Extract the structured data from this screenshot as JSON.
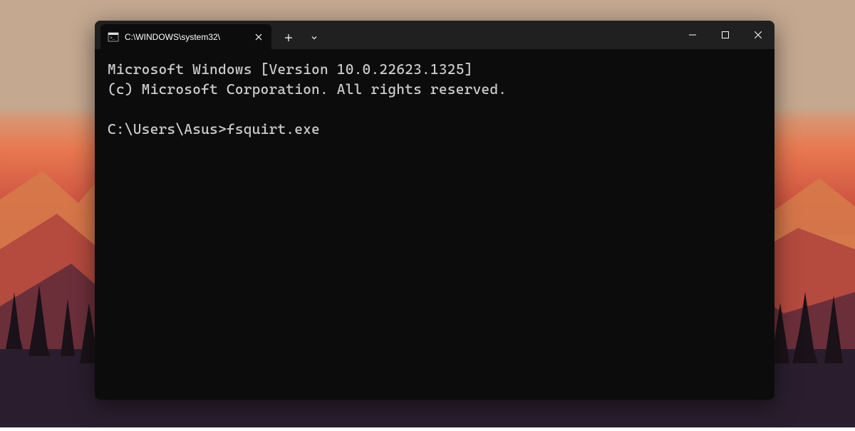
{
  "tab": {
    "title": "C:\\WINDOWS\\system32\\"
  },
  "terminal": {
    "line1": "Microsoft Windows [Version 10.0.22623.1325]",
    "line2": "(c) Microsoft Corporation. All rights reserved.",
    "line3": "",
    "prompt": "C:\\Users\\Asus>",
    "command": "fsquirt.exe"
  }
}
